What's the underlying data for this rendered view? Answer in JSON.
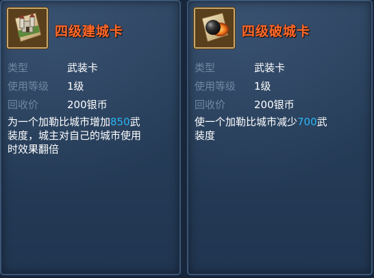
{
  "cards": [
    {
      "title": "四级建城卡",
      "icon": "castle-card-icon",
      "type_label": "类型",
      "type_value": "武装卡",
      "level_label": "使用等级",
      "level_value": "1级",
      "recycle_label": "回收价",
      "recycle_value": "200银币",
      "desc_line1_pre": "为一个加勒比城市增加",
      "desc_number": "850",
      "desc_line1_post": "武",
      "desc_line2": "装度，城主对自己的城市使用",
      "desc_line3": "时效果翻倍"
    },
    {
      "title": "四级破城卡",
      "icon": "cannonball-card-icon",
      "type_label": "类型",
      "type_value": "武装卡",
      "level_label": "使用等级",
      "level_value": "1级",
      "recycle_label": "回收价",
      "recycle_value": "200银币",
      "desc_line1_pre": "使一个加勒比城市减少",
      "desc_number": "700",
      "desc_line1_post": "武",
      "desc_line2": "装度"
    }
  ],
  "colors": {
    "title": "#ff6a2a",
    "label": "#6f87a2",
    "highlight": "#29b6f6",
    "frame_gold": "#c9a86a"
  }
}
